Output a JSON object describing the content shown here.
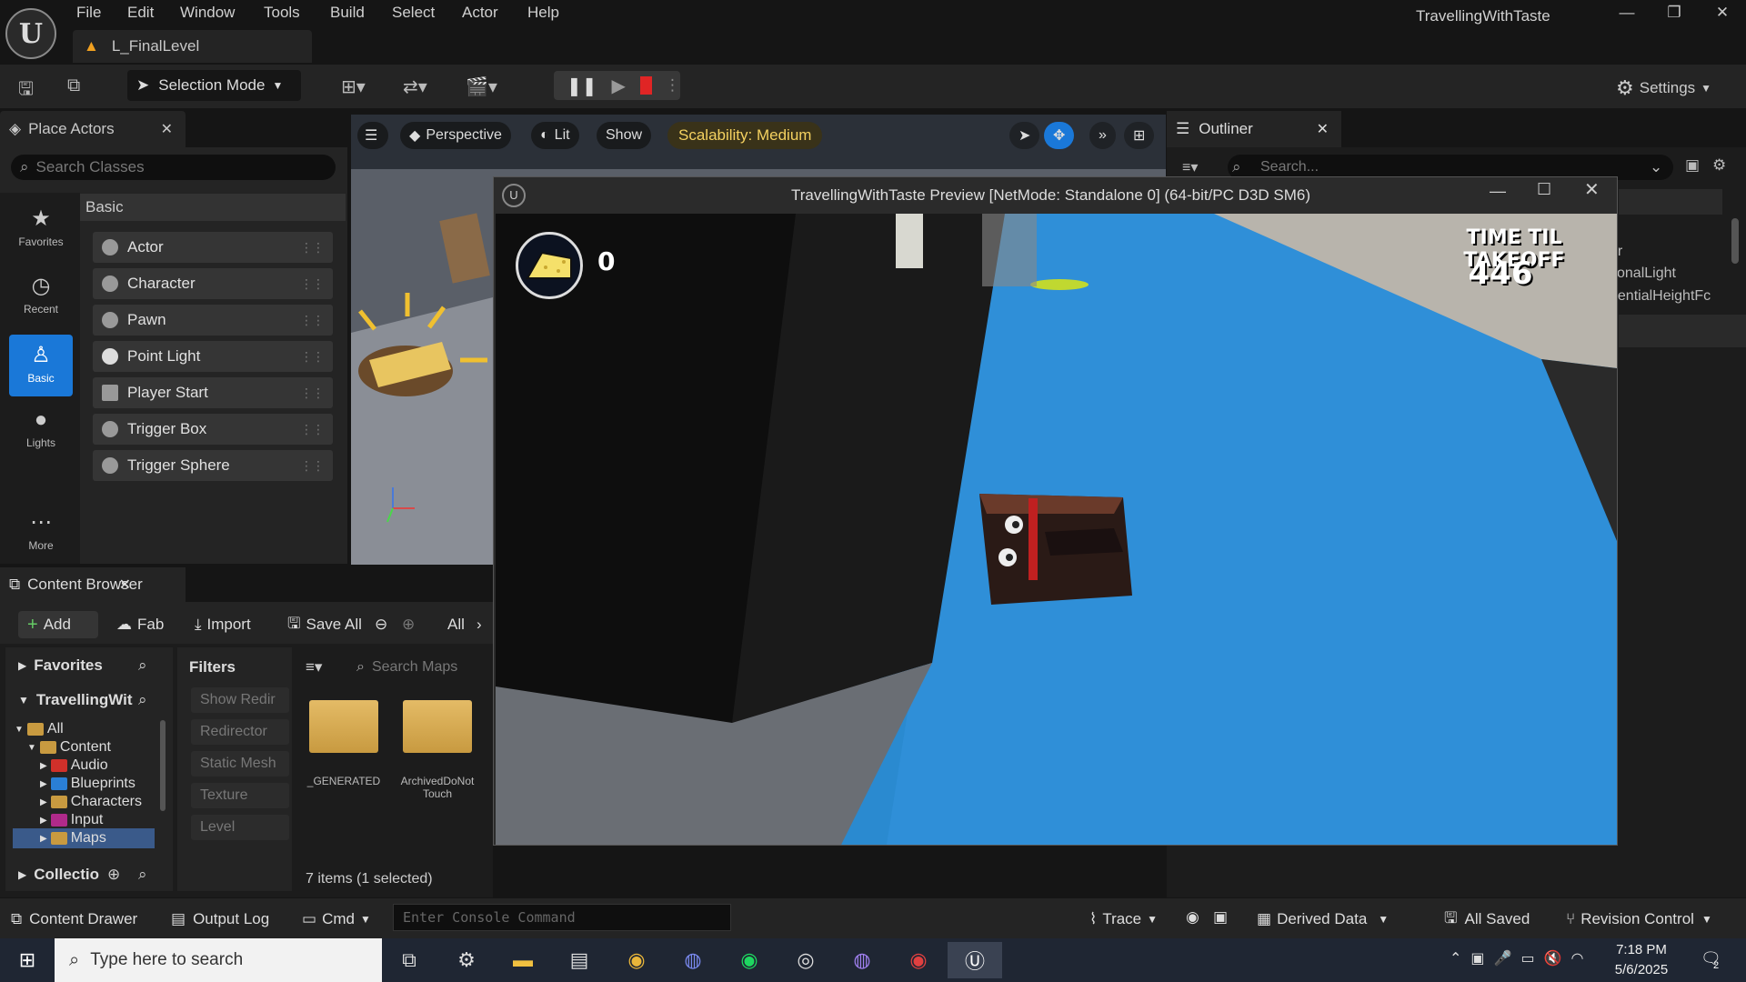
{
  "window": {
    "app_title": "TravellingWithTaste",
    "menu": [
      "File",
      "Edit",
      "Window",
      "Tools",
      "Build",
      "Select",
      "Actor",
      "Help"
    ],
    "level_tab": "L_FinalLevel"
  },
  "toolbar": {
    "selection_mode": "Selection Mode",
    "settings": "Settings"
  },
  "place_actors": {
    "tab": "Place Actors",
    "search_placeholder": "Search Classes",
    "categories": [
      {
        "label": "Favorites",
        "icon": "star-icon"
      },
      {
        "label": "Recent",
        "icon": "clock-icon"
      },
      {
        "label": "Basic",
        "icon": "basic-icon",
        "active": true
      },
      {
        "label": "Lights",
        "icon": "bulb-icon"
      },
      {
        "label": "More",
        "icon": "more-icon"
      }
    ],
    "section": "Basic",
    "items": [
      "Actor",
      "Character",
      "Pawn",
      "Point Light",
      "Player Start",
      "Trigger Box",
      "Trigger Sphere"
    ]
  },
  "viewport": {
    "perspective": "Perspective",
    "lit": "Lit",
    "show": "Show",
    "scalability": "Scalability: Medium"
  },
  "outliner": {
    "tab": "Outliner",
    "search_placeholder": "Search...",
    "rows": [
      "d",
      "er",
      "tionalLight",
      "nentialHeightFc"
    ]
  },
  "content_browser": {
    "tab": "Content Browser",
    "add": "Add",
    "fab": "Fab",
    "import": "Import",
    "save_all": "Save All",
    "all": "All",
    "favorites": "Favorites",
    "project": "TravellingWit",
    "tree": [
      {
        "label": "All",
        "color": "#c89a40",
        "level": 0
      },
      {
        "label": "Content",
        "color": "#c89a40",
        "level": 1
      },
      {
        "label": "Audio",
        "color": "#d0302a",
        "level": 2
      },
      {
        "label": "Blueprints",
        "color": "#2a7fd6",
        "level": 2
      },
      {
        "label": "Characters",
        "color": "#c89a40",
        "level": 2
      },
      {
        "label": "Input",
        "color": "#b02a8a",
        "level": 2
      },
      {
        "label": "Maps",
        "color": "#c89a40",
        "level": 2,
        "selected": true
      }
    ],
    "collections": "Collectio",
    "filters_title": "Filters",
    "filters": [
      "Show Redir",
      "Redirector",
      "Static Mesh",
      "Texture",
      "Level"
    ],
    "search_placeholder": "Search Maps",
    "assets": [
      "_GENERATED",
      "ArchivedDoNot Touch"
    ],
    "items_count": "7 items (1 selected)"
  },
  "game_window": {
    "caption": "TravellingWithTaste Preview [NetMode: Standalone 0]  (64-bit/PC D3D SM6)",
    "cheese_count": "0",
    "timer_label": "TIME TIL TAKEOFF",
    "timer_value": "446"
  },
  "statusbar": {
    "content_drawer": "Content Drawer",
    "output_log": "Output Log",
    "cmd": "Cmd",
    "console_placeholder": "Enter Console Command",
    "trace": "Trace",
    "derived_data": "Derived Data",
    "all_saved": "All Saved",
    "revision_control": "Revision Control"
  },
  "taskbar": {
    "search_placeholder": "Type here to search",
    "time": "7:18 PM",
    "date": "5/6/2025",
    "notifications": "2"
  }
}
